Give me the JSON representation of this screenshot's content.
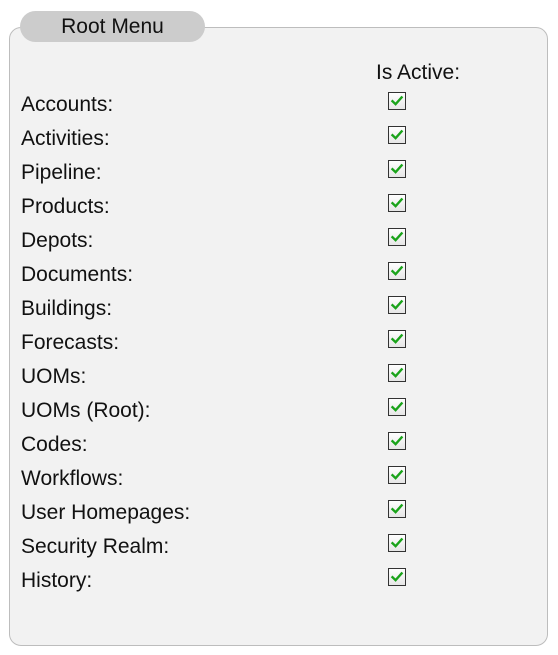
{
  "panel": {
    "title": "Root Menu",
    "column_header": "Is Active:"
  },
  "accent": {
    "check_color": "#1aa31a"
  },
  "rows": [
    {
      "label": "Accounts:",
      "active": true
    },
    {
      "label": "Activities:",
      "active": true
    },
    {
      "label": "Pipeline:",
      "active": true
    },
    {
      "label": "Products:",
      "active": true
    },
    {
      "label": "Depots:",
      "active": true
    },
    {
      "label": "Documents:",
      "active": true
    },
    {
      "label": "Buildings:",
      "active": true
    },
    {
      "label": "Forecasts:",
      "active": true
    },
    {
      "label": "UOMs:",
      "active": true
    },
    {
      "label": "UOMs (Root):",
      "active": true
    },
    {
      "label": "Codes:",
      "active": true
    },
    {
      "label": "Workflows:",
      "active": true
    },
    {
      "label": "User Homepages:",
      "active": true
    },
    {
      "label": "Security Realm:",
      "active": true
    },
    {
      "label": "History:",
      "active": true
    }
  ]
}
